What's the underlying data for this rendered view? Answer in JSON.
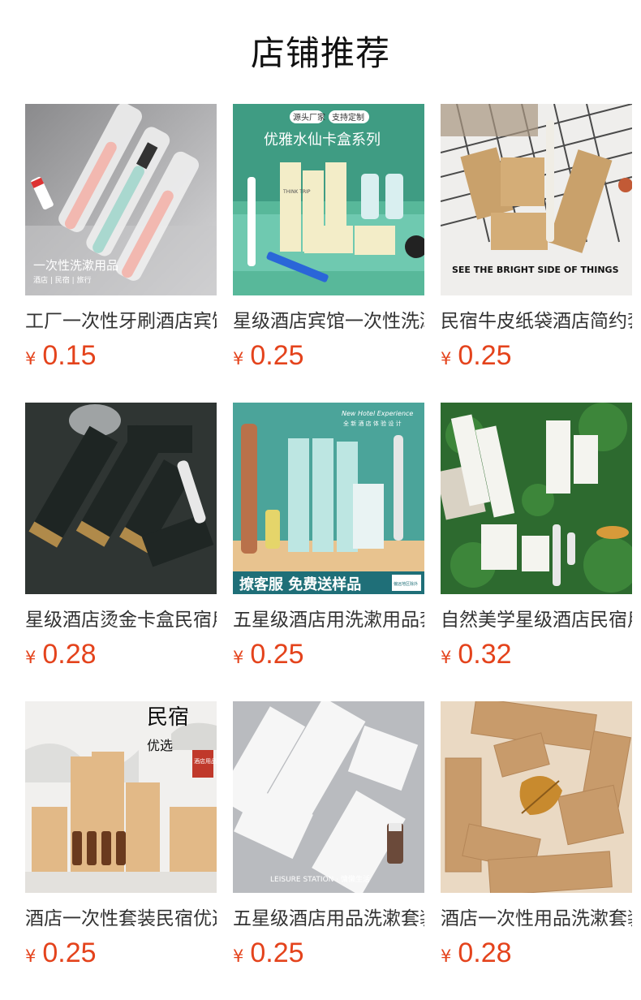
{
  "header": {
    "title": "店铺推荐"
  },
  "currency_symbol": "¥",
  "products": [
    {
      "name": "工厂一次性牙刷酒店宾馆民宿",
      "price": "0.15",
      "image_text": [
        "一次性洗漱用品",
        "酒店 | 民宿 | 旅行"
      ]
    },
    {
      "name": "星级酒店宾馆一次性洗漱用品",
      "price": "0.25",
      "image_text": [
        "源头厂家",
        "支持定制",
        "优雅水仙卡盒系列",
        "THINK TRIP"
      ]
    },
    {
      "name": "民宿牛皮纸袋酒店简约套装",
      "price": "0.25",
      "image_text": [
        "SEE THE BRIGHT SIDE OF THINGS"
      ]
    },
    {
      "name": "星级酒店烫金卡盒民宿用品",
      "price": "0.28",
      "image_text": []
    },
    {
      "name": "五星级酒店用洗漱用品套装",
      "price": "0.25",
      "image_text": [
        "New Hotel Experience",
        "全 新 酒 店 体 验 设 计",
        "撩客服 免费送样品",
        "偏远地区除外"
      ]
    },
    {
      "name": "自然美学星级酒店民宿用品",
      "price": "0.32",
      "image_text": []
    },
    {
      "name": "酒店一次性套装民宿优选用品",
      "price": "0.25",
      "image_text": [
        "民宿",
        "优选",
        "酒店用品"
      ]
    },
    {
      "name": "五星级酒店用品洗漱套装",
      "price": "0.25",
      "image_text": [
        "LEISURE STATION · 慵懒生活"
      ]
    },
    {
      "name": "酒店一次性用品洗漱套装",
      "price": "0.28",
      "image_text": []
    }
  ]
}
